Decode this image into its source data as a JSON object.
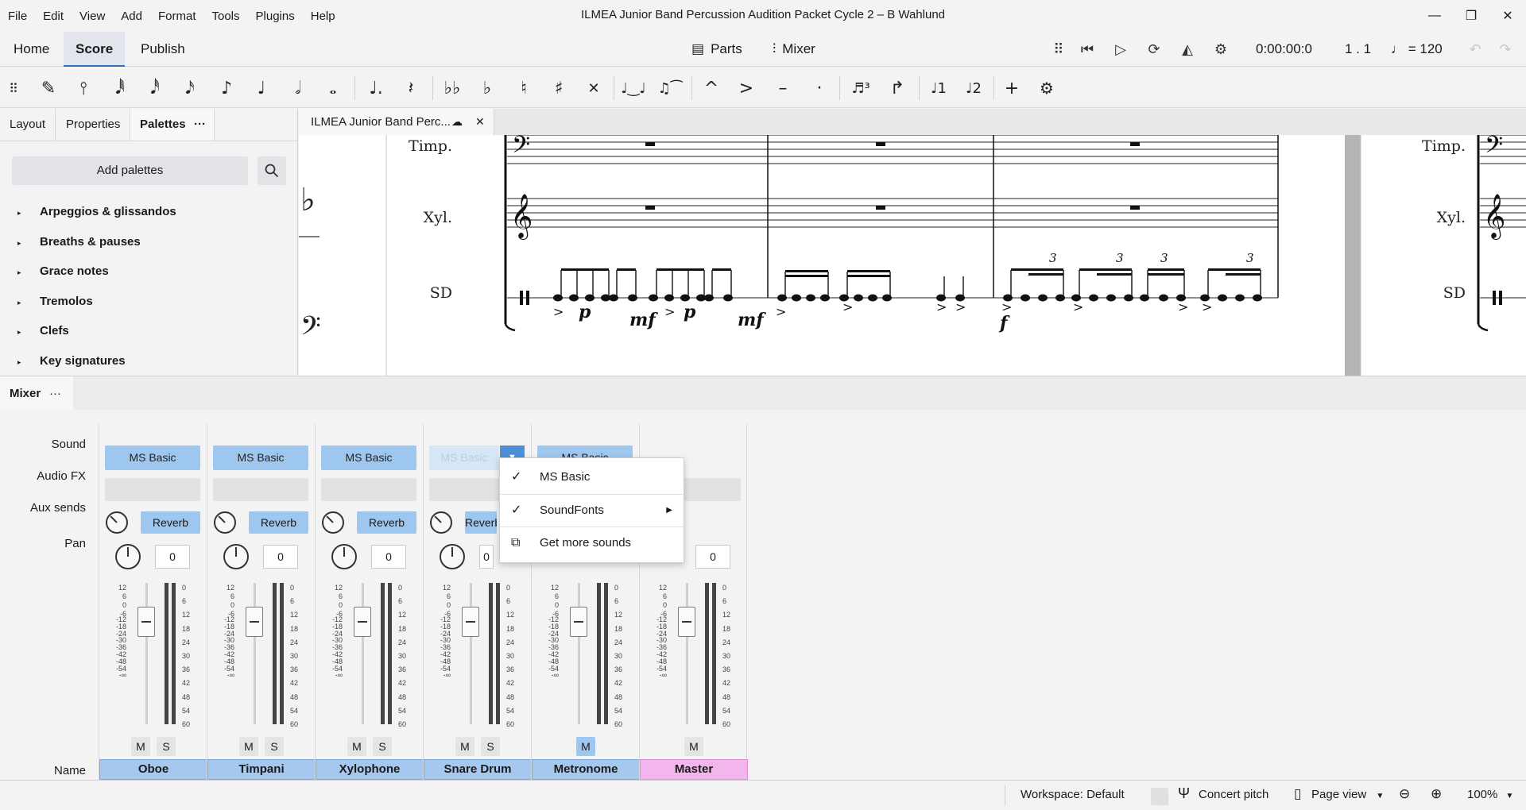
{
  "menubar": {
    "items": [
      "File",
      "Edit",
      "View",
      "Add",
      "Format",
      "Tools",
      "Plugins",
      "Help"
    ],
    "title": "ILMEA Junior Band Percussion Audition Packet Cycle 2 – B Wahlund"
  },
  "nav": {
    "tabs": [
      "Home",
      "Score",
      "Publish"
    ],
    "parts": "Parts",
    "mixer": "Mixer",
    "time": "0:00:00:0",
    "position": "1 . 1",
    "tempo": "♩ = 120"
  },
  "palette": {
    "tabs": [
      "Layout",
      "Properties",
      "Palettes"
    ],
    "add_label": "Add palettes",
    "items": [
      "Arpeggios & glissandos",
      "Breaths & pauses",
      "Grace notes",
      "Tremolos",
      "Clefs",
      "Key signatures"
    ]
  },
  "score": {
    "tab_title": "ILMEA Junior Band Perc...",
    "staves": [
      "Timp.",
      "Xyl.",
      "SD"
    ],
    "dynamics": [
      "p",
      "mf",
      "p",
      "mf",
      "f"
    ],
    "tuplet": "3"
  },
  "mixer": {
    "title": "Mixer",
    "row_labels": [
      "Sound",
      "Audio FX",
      "Aux sends",
      "Pan",
      "Name"
    ],
    "sound_label": "MS Basic",
    "reverb_label": "Reverb",
    "pan_value": "0",
    "mute": "M",
    "solo": "S",
    "fader_ticks_left": [
      "12",
      "6",
      "0",
      "-6",
      "-12",
      "-18",
      "-24",
      "-30",
      "-36",
      "-42",
      "-48",
      "-54",
      "-∞"
    ],
    "fader_ticks_right": [
      "0",
      "6",
      "12",
      "18",
      "24",
      "30",
      "36",
      "42",
      "48",
      "54",
      "60"
    ],
    "channels": [
      "Oboe",
      "Timpani",
      "Xylophone",
      "Snare Drum",
      "Metronome",
      "Master"
    ]
  },
  "dropdown": {
    "items": [
      "MS Basic",
      "SoundFonts",
      "Get more sounds"
    ]
  },
  "status": {
    "workspace": "Workspace: Default",
    "concert": "Concert pitch",
    "view": "Page view",
    "zoom": "100%"
  },
  "colors": {
    "accent": "#9ec7ef",
    "master": "#f3b6ec"
  }
}
